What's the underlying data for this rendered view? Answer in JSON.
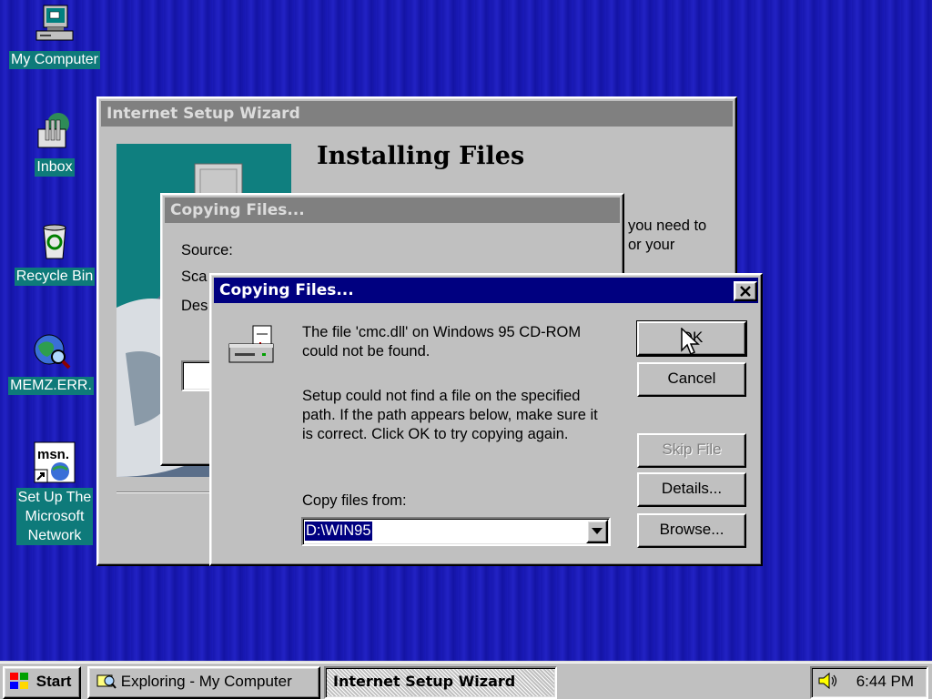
{
  "desktop": {
    "icons": [
      {
        "label": "My Computer"
      },
      {
        "label": "Inbox"
      },
      {
        "label": "Recycle Bin"
      },
      {
        "label": "MEMZ.ERR."
      },
      {
        "label_lines": [
          "Set Up The",
          "Microsoft",
          "Network"
        ],
        "logo_text": "msn."
      }
    ]
  },
  "wizard": {
    "title": "Internet Setup Wizard",
    "heading": "Installing Files",
    "text_line1": "you need to",
    "text_line2": "or your"
  },
  "copying_back": {
    "title": "Copying Files...",
    "source_label": "Source:",
    "scan_label": "Sca",
    "dest_label": "Des"
  },
  "error_dialog": {
    "title": "Copying Files...",
    "message_line1": "The file 'cmc.dll' on Windows 95 CD-ROM",
    "message_line2": "could not be found.",
    "detail_line1": "Setup could not find a file on the specified",
    "detail_line2": "path. If the path appears below, make sure it",
    "detail_line3": "is correct. Click OK to try copying again.",
    "copy_from_label": "Copy files from:",
    "copy_from_value": "D:\\WIN95",
    "buttons": {
      "ok": "OK",
      "cancel": "Cancel",
      "skip": "Skip File",
      "details": "Details...",
      "browse": "Browse..."
    }
  },
  "taskbar": {
    "start_label": "Start",
    "tasks": [
      "Exploring - My Computer",
      "Internet Setup Wizard"
    ],
    "clock": "6:44 PM"
  },
  "colors": {
    "desktop": "#1a1ab8",
    "active_title": "#000080",
    "inactive_title": "#808080",
    "face": "#c0c0c0",
    "icon_label_bg": "#0e7a7a"
  }
}
